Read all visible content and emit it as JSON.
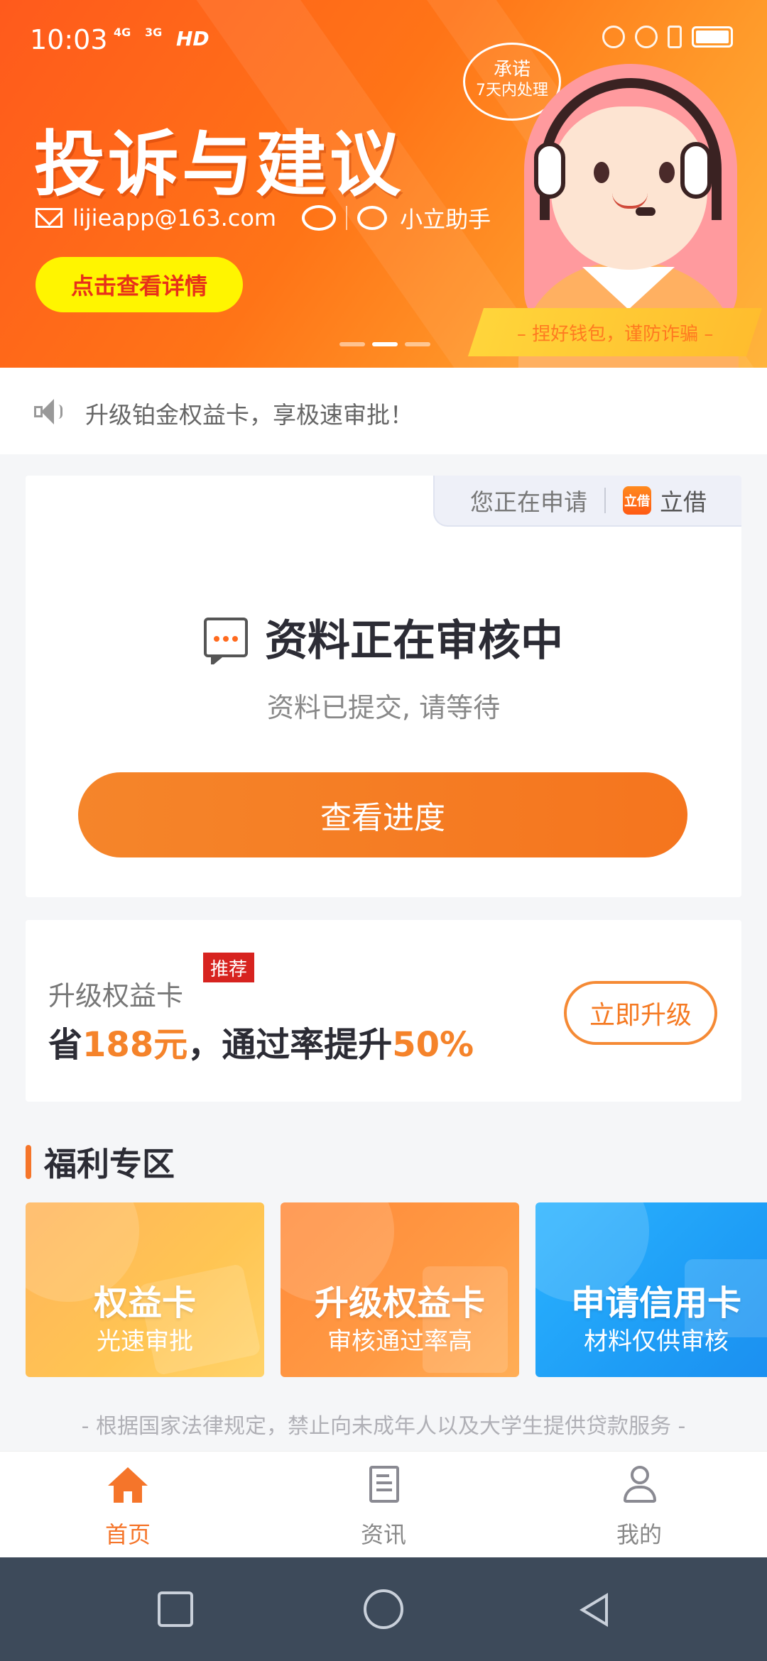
{
  "status_bar": {
    "time": "10:03",
    "signal_1": "4G",
    "signal_2": "3G",
    "hd": "HD",
    "battery_icon": "battery-icon"
  },
  "banner": {
    "title": "投诉与建议",
    "email": "lijieapp@163.com",
    "wechat_name": "小立助手",
    "button": "点击查看详情",
    "bubble_line1": "承诺",
    "bubble_line2": "7天内处理",
    "slogan": "– 捏好钱包，谨防诈骗 –",
    "active_slide_index": 1,
    "slide_count": 3
  },
  "notice": {
    "text": "升级铂金权益卡，享极速审批！"
  },
  "status_card": {
    "applying_label": "您正在申请",
    "app_logo_text": "立借",
    "app_name": "立借",
    "title": "资料正在审核中",
    "subtitle": "资料已提交, 请等待",
    "button": "查看进度"
  },
  "upgrade_card": {
    "label": "升级权益卡",
    "tag": "推荐",
    "line_prefix": "省",
    "amount": "188元",
    "line_middle": "，通过率提升",
    "rate": "50%",
    "button": "立即升级"
  },
  "welfare": {
    "title": "福利专区",
    "tiles": [
      {
        "title": "权益卡",
        "subtitle": "光速审批"
      },
      {
        "title": "升级权益卡",
        "subtitle": "审核通过率高"
      },
      {
        "title": "申请信用卡",
        "subtitle": "材料仅供审核"
      }
    ]
  },
  "legal_text": "- 根据国家法律规定，禁止向未成年人以及大学生提供贷款服务 -",
  "tabbar": {
    "items": [
      {
        "label": "首页",
        "icon": "home-icon",
        "active": true
      },
      {
        "label": "资讯",
        "icon": "news-icon",
        "active": false
      },
      {
        "label": "我的",
        "icon": "profile-icon",
        "active": false
      }
    ]
  },
  "colors": {
    "accent": "#f5752a",
    "banner_start": "#ff5a1c",
    "banner_button": "#fff500",
    "tag_red": "#d7231f",
    "blue_tile": "#1e9df6"
  }
}
